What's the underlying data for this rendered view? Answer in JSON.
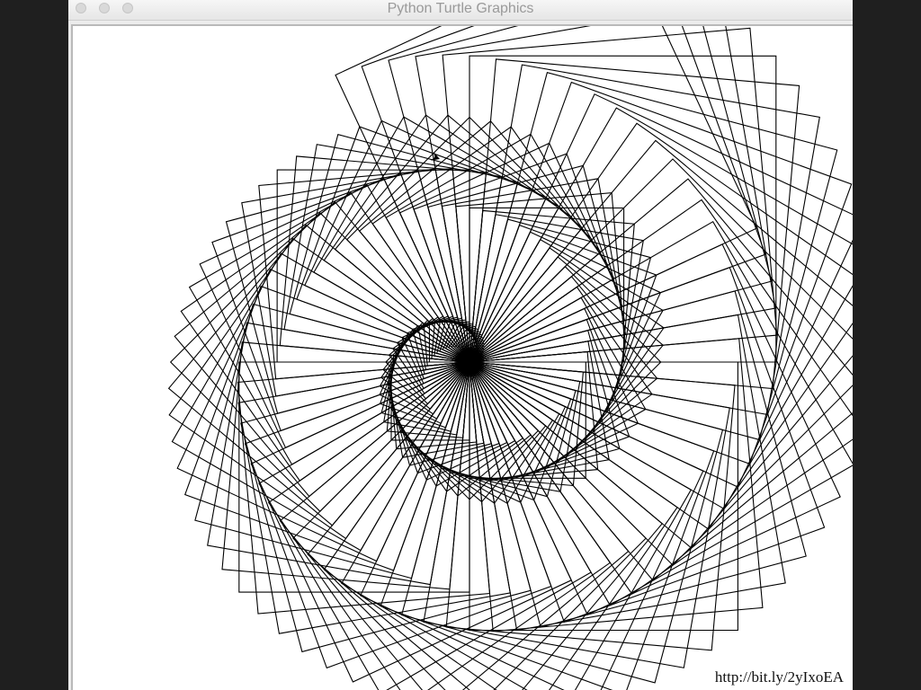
{
  "window": {
    "title": "Python Turtle Graphics"
  },
  "canvas": {
    "background": "#ffffff",
    "stroke_color": "#000000"
  },
  "turtle": {
    "shape": "classic-arrow",
    "color": "#000000"
  },
  "drawing": {
    "pattern": "rotating squares spiral"
  },
  "overlay": {
    "link_text": "http://bit.ly/2yIxoEA"
  }
}
